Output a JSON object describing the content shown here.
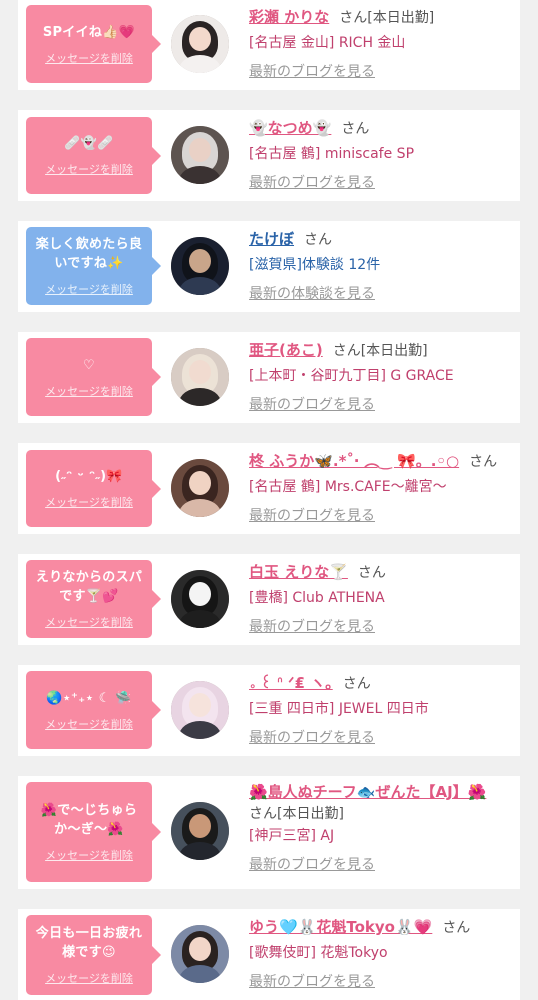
{
  "messages": [
    {
      "message": "SPイイね👍🏻💗",
      "delete_label": "メッセージを削除",
      "name": "彩瀬 かりな",
      "suffix": "さん",
      "tag": "[本日出勤]",
      "shop": "[名古屋 金山] RICH 金山",
      "link": "最新のブログを見る",
      "bubble_color": "#f88aa2"
    },
    {
      "message": "🩹👻🩹",
      "delete_label": "メッセージを削除",
      "name": "👻なつめ👻",
      "suffix": "さん",
      "tag": "",
      "shop": "[名古屋 鶴] miniscafe SP",
      "link": "最新のブログを見る",
      "bubble_color": "#f88aa2"
    },
    {
      "message": "楽しく飲めたら良いですね✨",
      "delete_label": "メッセージを削除",
      "name": "たけぼ",
      "suffix": "さん",
      "tag": "",
      "shop": "[滋賀県]体験談 12件",
      "link": "最新の体験談を見る",
      "bubble_color": "#82b2ec"
    },
    {
      "message": "♡",
      "delete_label": "メッセージを削除",
      "name": "亜子(あこ)",
      "suffix": "さん",
      "tag": "[本日出勤]",
      "shop": "[上本町・谷町九丁目] G GRACE",
      "link": "最新のブログを見る",
      "bubble_color": "#f88aa2"
    },
    {
      "message": "(˶ᵔ ᵕ ᵔ˶)🎀",
      "delete_label": "メッセージを削除",
      "name": "柊 ふうか🦋.*˚‧ ︵‿ 🎀。.◦○",
      "suffix": "さん",
      "tag": "",
      "shop": "[名古屋 鶴] Mrs.CAFE〜離宮〜",
      "link": "最新のブログを見る",
      "bubble_color": "#f88aa2"
    },
    {
      "message": "えりなからのスパです🍸💕",
      "delete_label": "メッセージを削除",
      "name": "白玉 えりな🍸",
      "suffix": "さん",
      "tag": "",
      "shop": "[豊橋] Club ATHENA",
      "link": "最新のブログを見る",
      "bubble_color": "#f88aa2"
    },
    {
      "message": "🌏⋆⁺₊⋆ ☾ 🛸",
      "delete_label": "メッセージを削除",
      "name": "｡ ꒰ ᐢ ᐟ₤ ヽ｡",
      "suffix": "さん",
      "tag": "",
      "shop": "[三重 四日市] JEWEL 四日市",
      "link": "最新のブログを見る",
      "bubble_color": "#f88aa2"
    },
    {
      "message": "🌺で〜じちゅらか〜ぎ〜🌺",
      "delete_label": "メッセージを削除",
      "name": "🌺島人ぬチーフ🐟ぜんた【AJ】🌺",
      "suffix": "さん",
      "tag": "[本日出勤]",
      "shop": "[神戸三宮] AJ",
      "link": "最新のブログを見る",
      "bubble_color": "#f88aa2"
    },
    {
      "message": "今日も一日お疲れ様です😉",
      "delete_label": "メッセージを削除",
      "name": "ゆう🩵🐰花魁Tokyo🐰💗",
      "suffix": "さん",
      "tag": "",
      "shop": "[歌舞伎町] 花魁Tokyo",
      "link": "最新のブログを見る",
      "bubble_color": "#f88aa2"
    }
  ]
}
